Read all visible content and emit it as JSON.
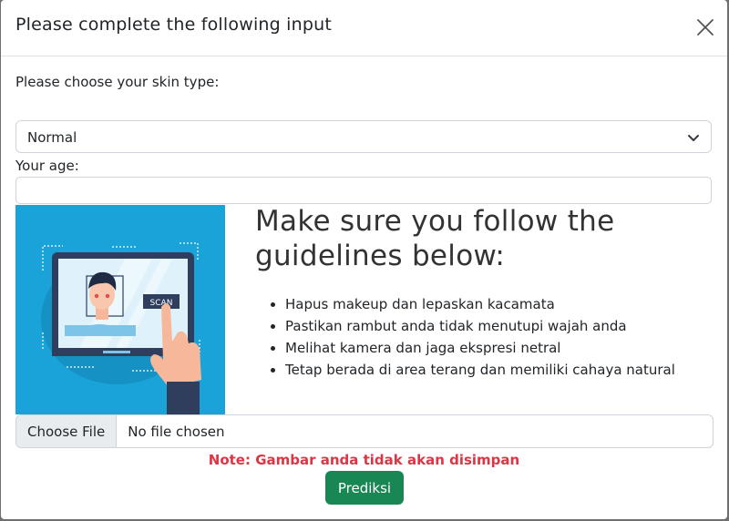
{
  "modal": {
    "title": "Please complete the following input",
    "close_icon": "close-icon"
  },
  "form": {
    "skin_type_label": "Please choose your skin type:",
    "skin_type_selected": "Normal",
    "age_label": "Your age:",
    "age_value": ""
  },
  "guidelines": {
    "title": "Make sure you follow the guidelines below:",
    "items": [
      "Hapus makeup dan lepaskan kacamata",
      "Pastikan rambut anda tidak menutupi wajah anda",
      "Melihat kamera dan jaga ekspresi netral",
      "Tetap berada di area terang dan memiliki cahaya natural"
    ],
    "illustration_text": "SCAN"
  },
  "upload": {
    "button_label": "Choose File",
    "status": "No file chosen"
  },
  "note": "Note: Gambar anda tidak akan disimpan",
  "submit_label": "Prediksi",
  "colors": {
    "accent_green": "#198754",
    "note_red": "#dc3545",
    "illustration_blue": "#1aa3d9"
  }
}
